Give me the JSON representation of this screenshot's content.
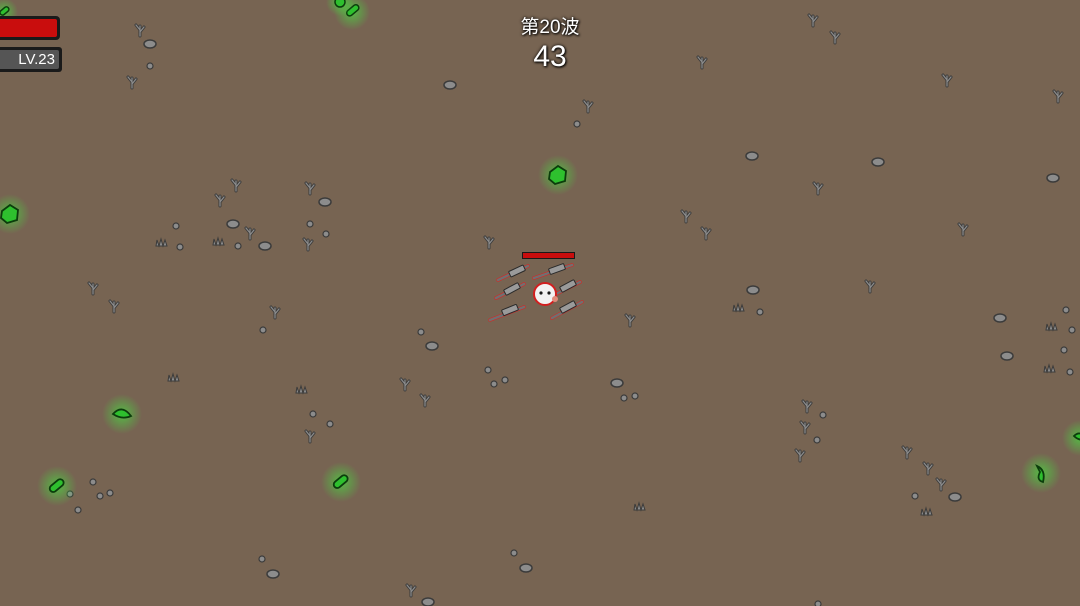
{
  "hud": {
    "level_label": "LV.23",
    "wave_label": "第20波",
    "wave_timer": "43",
    "hp_fraction": 1.0,
    "overhead_hp_fraction": 1.0
  },
  "colors": {
    "ground": "#776452",
    "hp_red": "#c90d0d",
    "material_green": "#2ec02e",
    "debris_gray": "#8c8c8c"
  }
}
